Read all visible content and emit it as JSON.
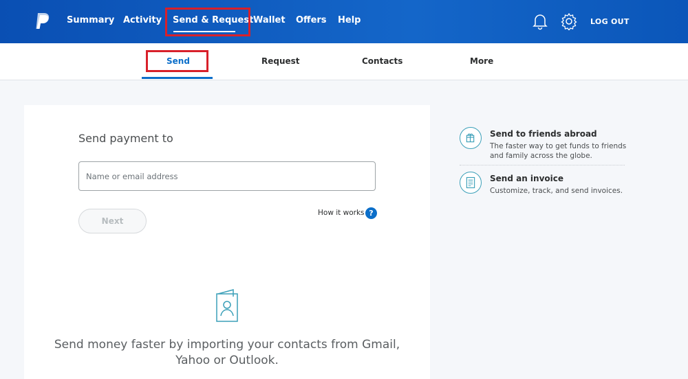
{
  "topnav": {
    "items": [
      "Summary",
      "Activity",
      "Send & Request",
      "Wallet",
      "Offers",
      "Help"
    ],
    "logout": "LOG OUT"
  },
  "subnav": {
    "items": [
      "Send",
      "Request",
      "Contacts",
      "More"
    ]
  },
  "send_card": {
    "title": "Send payment to",
    "input_placeholder": "Name or email address",
    "next_label": "Next",
    "how_it_works": "How it works",
    "help_glyph": "?",
    "import_line1": "Send money faster by importing your contacts from Gmail,",
    "import_line2": "Yahoo or Outlook."
  },
  "side": {
    "items": [
      {
        "title": "Send to friends abroad",
        "desc": "The faster way to get funds to friends and family across the globe.",
        "icon": "globe-gift-icon"
      },
      {
        "title": "Send an invoice",
        "desc": "Customize, track, and send invoices.",
        "icon": "invoice-icon"
      }
    ]
  },
  "colors": {
    "header": "#0a4fb3",
    "accent": "#0b6ec9",
    "highlight": "#d8202a",
    "side_icon": "#3a9fb8"
  }
}
